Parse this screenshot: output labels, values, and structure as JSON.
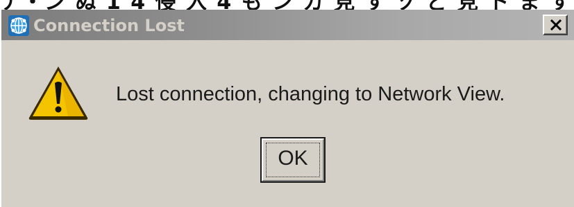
{
  "window": {
    "title": "Connection Lost",
    "app_icon": "network-globe-icon",
    "close_icon": "close-icon"
  },
  "dialog": {
    "icon": "warning-icon",
    "message": "Lost connection, changing to Network View.",
    "ok_label": "OK"
  },
  "colors": {
    "face": "#d4d0c8",
    "titlebar_start": "#7c7c7c",
    "titlebar_end": "#b4b4b4",
    "warning_yellow": "#f5c400"
  }
}
